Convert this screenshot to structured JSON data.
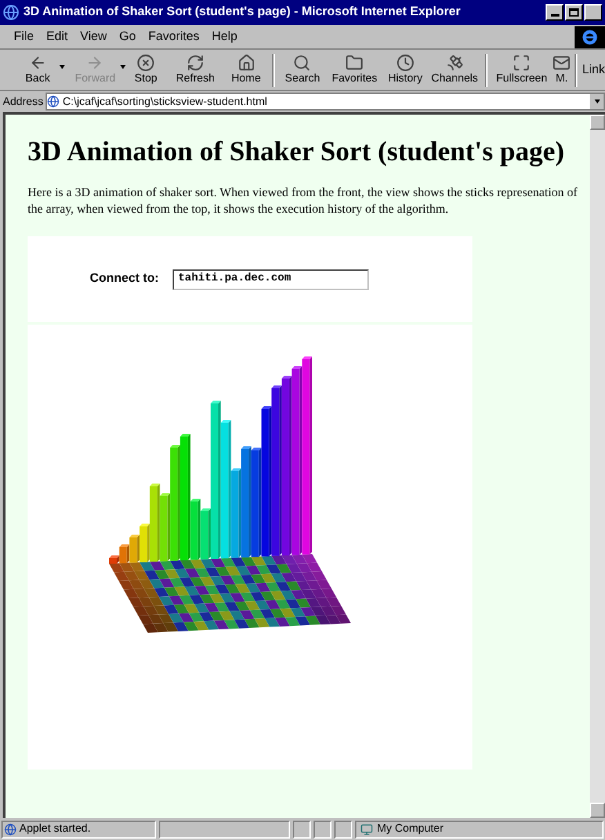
{
  "window": {
    "title": "3D Animation of Shaker Sort (student's page) - Microsoft Internet Explorer"
  },
  "menu": [
    "File",
    "Edit",
    "View",
    "Go",
    "Favorites",
    "Help"
  ],
  "toolbar": [
    {
      "label": "Back",
      "disabled": false,
      "dropdown": true
    },
    {
      "label": "Forward",
      "disabled": true,
      "dropdown": true
    },
    {
      "label": "Stop",
      "disabled": false,
      "dropdown": false
    },
    {
      "label": "Refresh",
      "disabled": false,
      "dropdown": false
    },
    {
      "label": "Home",
      "disabled": false,
      "dropdown": false
    },
    {
      "label": "Search",
      "disabled": false,
      "dropdown": false
    },
    {
      "label": "Favorites",
      "disabled": false,
      "dropdown": false
    },
    {
      "label": "History",
      "disabled": false,
      "dropdown": false
    },
    {
      "label": "Channels",
      "disabled": false,
      "dropdown": false
    },
    {
      "label": "Fullscreen",
      "disabled": false,
      "dropdown": false
    },
    {
      "label": "M.",
      "disabled": false,
      "dropdown": false
    }
  ],
  "links_label": "Link",
  "address": {
    "label": "Address",
    "value": "C:\\jcaf\\jcaf\\sorting\\sticksview-student.html"
  },
  "page": {
    "heading": "3D Animation of Shaker Sort (student's page)",
    "paragraph": "Here is a 3D animation of shaker sort. When viewed from the front, the view shows the sticks represenation of the array, when viewed from the top, it shows the execution history of the algorithm.",
    "applet": {
      "connect_label": "Connect to:",
      "connect_value": "tahiti.pa.dec.com"
    }
  },
  "status_bar": {
    "message": "Applet started.",
    "zone": "My Computer"
  }
}
